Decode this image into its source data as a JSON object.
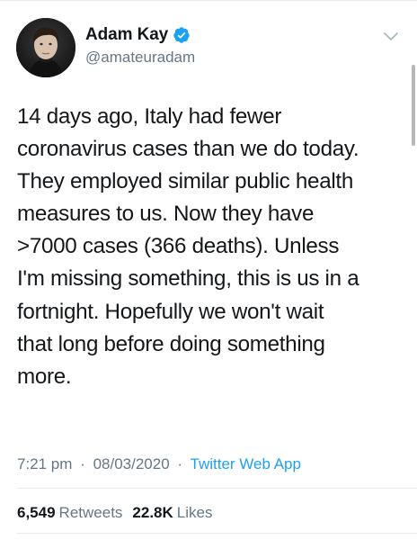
{
  "tweet": {
    "author": {
      "display_name": "Adam Kay",
      "handle": "@amateuradam",
      "verified_icon": "verified-badge-icon"
    },
    "text": "14 days ago, Italy had fewer\ncoronavirus cases than we do today.\nThey employed similar public health\nmeasures to us. Now they have\n>7000 cases (366 deaths). Unless\nI'm missing something, this is us in a\nfortnight. Hopefully we won't wait\nthat long before doing something\nmore.",
    "meta": {
      "time": "7:21 pm",
      "separator": "·",
      "date": "08/03/2020",
      "source": "Twitter Web App"
    },
    "stats": {
      "retweets_count": "6,549",
      "retweets_label": "Retweets",
      "likes_count": "22.8K",
      "likes_label": "Likes"
    }
  },
  "colors": {
    "text": "#14171a",
    "secondary": "#657786",
    "accent": "#1da1f2",
    "divider": "#e6ecf0"
  }
}
